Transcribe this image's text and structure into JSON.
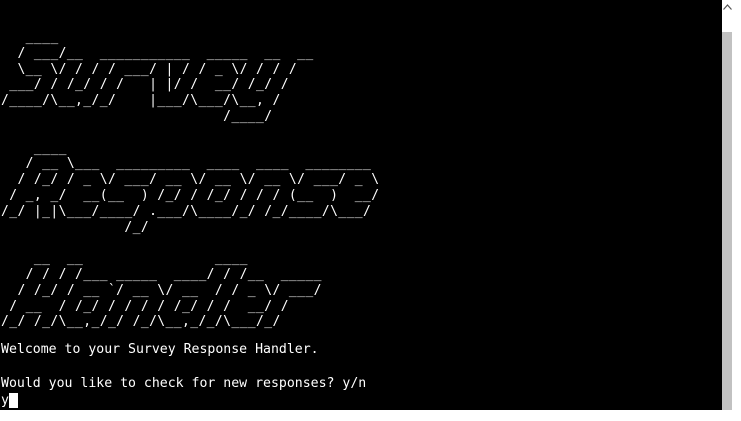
{
  "terminal": {
    "banner_lines": [
      "   ____",
      "  / ___/__  ___________  _____  __  __",
      "  \\__ \\/ / / / ___/ | / / _ \\/ / / /",
      " ___/ / /_/ / /   | |/ /  __/ /_/ /",
      "/____/\\__,_/_/    |___/\\___/\\__, /",
      "                           /____/",
      "",
      "    ____",
      "   / __ \\___  _________  ____  ____  ________",
      "  / /_/ / _ \\/ ___/ __ \\/ __ \\/ __ \\/ ___/ _ \\",
      " / _, _/  __(__  ) /_/ / /_/ / / / (__  )  __/",
      "/_/ |_|\\___/____/ .___/\\____/_/ /_/____/\\___/",
      "               /_/",
      "",
      "    __  __                ____",
      "   / / / /___ _____  ____/ / /__  _____",
      "  / /_/ / __ `/ __ \\/ __  / / _ \\/ ___/",
      " / __  / /_/ / / / / /_/ / /  __/ /",
      "/_/ /_/\\__,_/_/ /_/\\__,_/_/\\___/_/"
    ],
    "welcome_text": "Welcome to your Survey Response Handler.",
    "prompt_text": "Would you like to check for new responses? y/n",
    "input_value": "y"
  },
  "scrollbar": {
    "up_arrow_icon": "chevron-up-icon"
  },
  "colors": {
    "terminal_bg": "#000000",
    "terminal_fg": "#ffffff",
    "scrollbar_thumb": "#c1c1c1"
  }
}
